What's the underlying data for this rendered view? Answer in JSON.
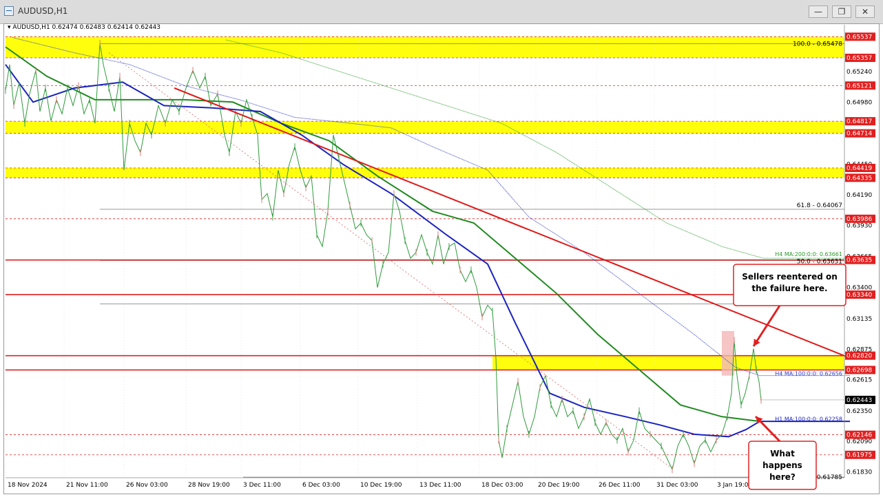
{
  "window": {
    "title": "AUDUSD,H1",
    "minimize_glyph": "—",
    "restore_glyph": "❐",
    "close_glyph": "✕"
  },
  "chart_header": {
    "symbol": "AUDUSD,H1",
    "ohlc": "0.62474 0.62483 0.62414 0.62443"
  },
  "chart_data": {
    "type": "line",
    "series_shown": [
      "price",
      "H1 MA 100",
      "H1 MA 200",
      "H4 MA 100",
      "H4 MA 200"
    ],
    "x_ticks": [
      "18 Nov 2024",
      "21 Nov 11:00",
      "26 Nov 03:00",
      "28 Nov 19:00",
      "3 Dec 11:00",
      "6 Dec 03:00",
      "10 Dec 19:00",
      "13 Dec 11:00",
      "18 Dec 03:00",
      "20 Dec 19:00",
      "26 Dec 11:00",
      "31 Dec 03:00",
      "3 Jan 19:00"
    ],
    "y_ticks": [
      "0.65240",
      "0.64980",
      "0.64450",
      "0.64190",
      "0.63930",
      "0.63665",
      "0.63400",
      "0.63135",
      "0.62875",
      "0.62615",
      "0.62350",
      "0.62090",
      "0.61830"
    ],
    "ylim": [
      0.6178,
      0.6558
    ],
    "price": {
      "points": [
        [
          0,
          0.6508
        ],
        [
          6,
          0.653
        ],
        [
          12,
          0.6495
        ],
        [
          20,
          0.6515
        ],
        [
          28,
          0.648
        ],
        [
          35,
          0.6505
        ],
        [
          44,
          0.6525
        ],
        [
          50,
          0.649
        ],
        [
          58,
          0.651
        ],
        [
          66,
          0.6482
        ],
        [
          74,
          0.65
        ],
        [
          82,
          0.6488
        ],
        [
          90,
          0.651
        ],
        [
          98,
          0.6495
        ],
        [
          106,
          0.6512
        ],
        [
          114,
          0.6488
        ],
        [
          122,
          0.65
        ],
        [
          130,
          0.648
        ],
        [
          137,
          0.6548
        ],
        [
          142,
          0.653
        ],
        [
          150,
          0.651
        ],
        [
          158,
          0.649
        ],
        [
          166,
          0.652
        ],
        [
          172,
          0.644
        ],
        [
          180,
          0.648
        ],
        [
          188,
          0.6465
        ],
        [
          196,
          0.6455
        ],
        [
          204,
          0.648
        ],
        [
          212,
          0.647
        ],
        [
          222,
          0.6495
        ],
        [
          232,
          0.648
        ],
        [
          242,
          0.65
        ],
        [
          252,
          0.649
        ],
        [
          262,
          0.651
        ],
        [
          272,
          0.6525
        ],
        [
          282,
          0.651
        ],
        [
          290,
          0.652
        ],
        [
          298,
          0.6495
        ],
        [
          308,
          0.6505
        ],
        [
          318,
          0.647
        ],
        [
          325,
          0.6455
        ],
        [
          334,
          0.649
        ],
        [
          342,
          0.648
        ],
        [
          350,
          0.65
        ],
        [
          358,
          0.6485
        ],
        [
          366,
          0.647
        ],
        [
          372,
          0.6415
        ],
        [
          380,
          0.642
        ],
        [
          388,
          0.64
        ],
        [
          396,
          0.644
        ],
        [
          404,
          0.642
        ],
        [
          412,
          0.6445
        ],
        [
          420,
          0.646
        ],
        [
          428,
          0.644
        ],
        [
          436,
          0.6425
        ],
        [
          444,
          0.6435
        ],
        [
          452,
          0.6385
        ],
        [
          460,
          0.6375
        ],
        [
          468,
          0.6405
        ],
        [
          476,
          0.647
        ],
        [
          484,
          0.645
        ],
        [
          492,
          0.643
        ],
        [
          500,
          0.641
        ],
        [
          508,
          0.639
        ],
        [
          516,
          0.6395
        ],
        [
          524,
          0.6385
        ],
        [
          532,
          0.638
        ],
        [
          540,
          0.634
        ],
        [
          548,
          0.636
        ],
        [
          556,
          0.637
        ],
        [
          564,
          0.642
        ],
        [
          572,
          0.6405
        ],
        [
          580,
          0.638
        ],
        [
          588,
          0.6365
        ],
        [
          596,
          0.637
        ],
        [
          604,
          0.6385
        ],
        [
          612,
          0.637
        ],
        [
          620,
          0.636
        ],
        [
          628,
          0.6385
        ],
        [
          636,
          0.636
        ],
        [
          644,
          0.6375
        ],
        [
          652,
          0.6378
        ],
        [
          660,
          0.6355
        ],
        [
          668,
          0.6345
        ],
        [
          676,
          0.6355
        ],
        [
          684,
          0.634
        ],
        [
          692,
          0.6315
        ],
        [
          700,
          0.6325
        ],
        [
          707,
          0.632
        ],
        [
          712,
          0.628
        ],
        [
          716,
          0.621
        ],
        [
          721,
          0.6195
        ],
        [
          728,
          0.622
        ],
        [
          736,
          0.624
        ],
        [
          744,
          0.626
        ],
        [
          752,
          0.623
        ],
        [
          760,
          0.6215
        ],
        [
          768,
          0.623
        ],
        [
          776,
          0.6255
        ],
        [
          784,
          0.6265
        ],
        [
          792,
          0.624
        ],
        [
          800,
          0.623
        ],
        [
          808,
          0.6245
        ],
        [
          816,
          0.623
        ],
        [
          824,
          0.6235
        ],
        [
          832,
          0.622
        ],
        [
          840,
          0.623
        ],
        [
          848,
          0.6245
        ],
        [
          856,
          0.6225
        ],
        [
          864,
          0.6215
        ],
        [
          872,
          0.6225
        ],
        [
          880,
          0.6215
        ],
        [
          888,
          0.621
        ],
        [
          896,
          0.622
        ],
        [
          904,
          0.62
        ],
        [
          912,
          0.621
        ],
        [
          920,
          0.6235
        ],
        [
          928,
          0.622
        ],
        [
          936,
          0.6215
        ],
        [
          944,
          0.621
        ],
        [
          952,
          0.6205
        ],
        [
          960,
          0.6195
        ],
        [
          968,
          0.6185
        ],
        [
          976,
          0.6205
        ],
        [
          984,
          0.6215
        ],
        [
          992,
          0.6205
        ],
        [
          1000,
          0.619
        ],
        [
          1008,
          0.6205
        ],
        [
          1016,
          0.621
        ],
        [
          1024,
          0.62
        ],
        [
          1032,
          0.621
        ],
        [
          1040,
          0.6215
        ],
        [
          1048,
          0.623
        ],
        [
          1054,
          0.625
        ],
        [
          1058,
          0.6295
        ],
        [
          1062,
          0.6265
        ],
        [
          1068,
          0.624
        ],
        [
          1074,
          0.625
        ],
        [
          1080,
          0.6265
        ],
        [
          1086,
          0.6288
        ],
        [
          1090,
          0.627
        ],
        [
          1094,
          0.626
        ],
        [
          1097,
          0.6244
        ]
      ]
    },
    "h1_ma100": [
      [
        0,
        0.653
      ],
      [
        40,
        0.6498
      ],
      [
        100,
        0.651
      ],
      [
        170,
        0.6515
      ],
      [
        230,
        0.6495
      ],
      [
        300,
        0.6493
      ],
      [
        370,
        0.649
      ],
      [
        430,
        0.647
      ],
      [
        490,
        0.6445
      ],
      [
        560,
        0.642
      ],
      [
        640,
        0.6385
      ],
      [
        700,
        0.636
      ],
      [
        740,
        0.631
      ],
      [
        790,
        0.625
      ],
      [
        840,
        0.6238
      ],
      [
        900,
        0.623
      ],
      [
        950,
        0.6223
      ],
      [
        1000,
        0.6215
      ],
      [
        1050,
        0.6213
      ],
      [
        1075,
        0.6219
      ],
      [
        1095,
        0.6226
      ],
      [
        1226,
        0.6226
      ]
    ],
    "h1_ma200": [
      [
        0,
        0.6545
      ],
      [
        60,
        0.652
      ],
      [
        130,
        0.65
      ],
      [
        200,
        0.65
      ],
      [
        260,
        0.65
      ],
      [
        330,
        0.6498
      ],
      [
        400,
        0.648
      ],
      [
        470,
        0.6465
      ],
      [
        540,
        0.6435
      ],
      [
        620,
        0.6405
      ],
      [
        680,
        0.6395
      ],
      [
        740,
        0.6365
      ],
      [
        800,
        0.6335
      ],
      [
        860,
        0.63
      ],
      [
        920,
        0.627
      ],
      [
        980,
        0.624
      ],
      [
        1040,
        0.623
      ],
      [
        1095,
        0.6226
      ]
    ],
    "h4_ma100": [
      [
        10,
        0.6553
      ],
      [
        100,
        0.654
      ],
      [
        180,
        0.653
      ],
      [
        260,
        0.6512
      ],
      [
        340,
        0.65
      ],
      [
        420,
        0.6485
      ],
      [
        500,
        0.648
      ],
      [
        560,
        0.6476
      ],
      [
        620,
        0.646
      ],
      [
        700,
        0.644
      ],
      [
        760,
        0.64
      ],
      [
        840,
        0.637
      ],
      [
        920,
        0.6335
      ],
      [
        1000,
        0.63
      ],
      [
        1060,
        0.6272
      ],
      [
        1095,
        0.6265
      ],
      [
        1226,
        0.6265
      ]
    ],
    "h4_ma200": [
      [
        320,
        0.6551
      ],
      [
        400,
        0.654
      ],
      [
        480,
        0.6525
      ],
      [
        560,
        0.651
      ],
      [
        640,
        0.6495
      ],
      [
        720,
        0.648
      ],
      [
        800,
        0.6455
      ],
      [
        880,
        0.6425
      ],
      [
        960,
        0.6395
      ],
      [
        1040,
        0.6375
      ],
      [
        1100,
        0.6365
      ],
      [
        1226,
        0.6365
      ]
    ],
    "zones": [
      {
        "low": 0.65357,
        "high": 0.65537
      },
      {
        "low": 0.64714,
        "high": 0.64817
      },
      {
        "low": 0.64335,
        "high": 0.64419
      },
      {
        "low": 0.62698,
        "high": 0.6282,
        "x_from": 707
      }
    ],
    "red_levels": [
      {
        "value": 0.65537,
        "label": "0.65537"
      },
      {
        "value": 0.65357,
        "label": "0.65357"
      },
      {
        "value": 0.65121,
        "label": "0.65121"
      },
      {
        "value": 0.64817,
        "label": "0.64817"
      },
      {
        "value": 0.64714,
        "label": "0.64714"
      },
      {
        "value": 0.64419,
        "label": "0.64419"
      },
      {
        "value": 0.64335,
        "label": "0.64335"
      },
      {
        "value": 0.63986,
        "label": "0.63986"
      },
      {
        "value": 0.63635,
        "label": "0.63635",
        "solid": true
      },
      {
        "value": 0.6334,
        "label": "0.63340",
        "solid": true
      },
      {
        "value": 0.6282,
        "label": "0.62820",
        "solid": true
      },
      {
        "value": 0.62698,
        "label": "0.62698",
        "solid": true
      },
      {
        "value": 0.62146,
        "label": "0.62146"
      },
      {
        "value": 0.61975,
        "label": "0.61975"
      }
    ],
    "current_price": {
      "value": 0.62443,
      "label": "0.62443"
    },
    "fib_levels": [
      {
        "value": 0.65478,
        "label": "100.0 - 0.65478"
      },
      {
        "value": 0.64067,
        "label": "61.8 - 0.64067"
      },
      {
        "value": 0.63631,
        "label": "50.0 - 0.63631"
      },
      {
        "value": 0.61785,
        "label": "0.61785"
      }
    ],
    "ma_labels": {
      "h4_200": "H4 MA:200:0:0: 0.63661",
      "h4_100": "H4 MA:100:0:0: 0.62656",
      "h1_100": "H1 MA:100:0:0: 0.62258"
    },
    "trendline": {
      "start": [
        245,
        0.651
      ],
      "end": [
        1226,
        0.628
      ]
    },
    "dotted_trendline": {
      "start": [
        150,
        0.654
      ],
      "end": [
        970,
        0.6185
      ]
    },
    "annotations": [
      {
        "text_lines": [
          "Sellers reentered on",
          "the failure here."
        ]
      },
      {
        "text_lines": [
          "What",
          "happens",
          "here?"
        ]
      }
    ],
    "highlight_candle": {
      "x": 1055,
      "low": 0.6265,
      "high": 0.6303
    }
  }
}
